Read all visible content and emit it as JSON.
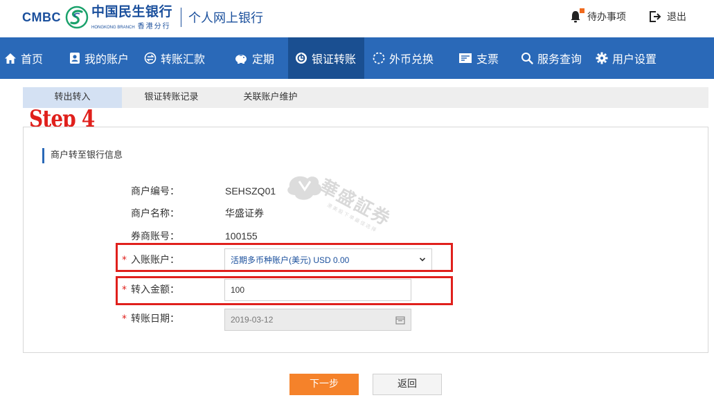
{
  "header": {
    "brand_en": "CMBC",
    "brand_cn": "中国民生银行",
    "branch_en": "HONGKONG BRANCH",
    "branch_cn": "香港分行",
    "product": "个人网上银行",
    "todo_label": "待办事项",
    "logout_label": "退出"
  },
  "nav": {
    "items": [
      {
        "label": "首页",
        "icon": "home-icon"
      },
      {
        "label": "我的账户",
        "icon": "account-icon"
      },
      {
        "label": "转账汇款",
        "icon": "transfer-icon"
      },
      {
        "label": "定期",
        "icon": "piggy-bank-icon"
      },
      {
        "label": "银证转账",
        "icon": "securities-icon",
        "active": true
      },
      {
        "label": "外币兑换",
        "icon": "exchange-icon"
      },
      {
        "label": "支票",
        "icon": "cheque-icon"
      },
      {
        "label": "服务查询",
        "icon": "search-icon"
      },
      {
        "label": "用户设置",
        "icon": "gear-icon"
      }
    ]
  },
  "subtabs": [
    {
      "label": "转出转入",
      "active": true
    },
    {
      "label": "银证转账记录"
    },
    {
      "label": "关联账户维护"
    }
  ],
  "step_label": "Step 4",
  "section_title": "商户转至银行信息",
  "form": {
    "merchant_no_label": "商户编号：",
    "merchant_no": "SEHSZQ01",
    "merchant_name_label": "商户名称：",
    "merchant_name": "华盛证券",
    "broker_account_label": "券商账号：",
    "broker_account": "100155",
    "required_mark": "*",
    "to_account_label": "入账账户：",
    "to_account_value": "活期多币种账户(美元) USD 0.00",
    "amount_label": "转入金额：",
    "amount_value": "100",
    "date_label": "转账日期：",
    "date_value": "2019-03-12"
  },
  "watermark": {
    "text": "華盛証券",
    "sub": "港美股下单最佳选择"
  },
  "buttons": {
    "next": "下一步",
    "back": "返回"
  },
  "colors": {
    "nav_bg": "#2a69b8",
    "nav_active": "#1a4f91",
    "brand": "#1a4f9c",
    "primary_button": "#f5822a",
    "highlight": "#e0201c"
  }
}
